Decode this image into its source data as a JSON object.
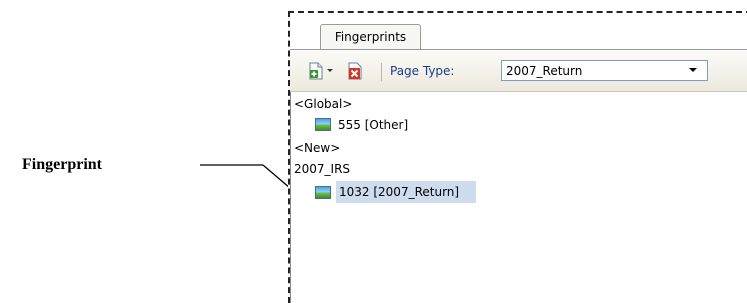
{
  "callout": {
    "label": "Fingerprint"
  },
  "panel": {
    "tab_label": "Fingerprints",
    "toolbar": {
      "add_icon": "add-document-icon",
      "delete_icon": "delete-icon",
      "page_type_label": "Page Type:",
      "page_type_value": "2007_Return"
    },
    "tree": {
      "groups": [
        {
          "label": "<Global>",
          "items": [
            {
              "label": "555 [Other]",
              "icon": "image-icon",
              "selected": false
            }
          ]
        },
        {
          "label": "<New>",
          "items": []
        },
        {
          "label": "2007_IRS",
          "items": [
            {
              "label": "1032 [2007_Return]",
              "icon": "image-icon",
              "selected": true
            }
          ]
        }
      ]
    }
  },
  "colors": {
    "page_type_label": "#1d3b8d",
    "selection": "#cfdcee",
    "toolbar_bg": "#ece9dd"
  }
}
